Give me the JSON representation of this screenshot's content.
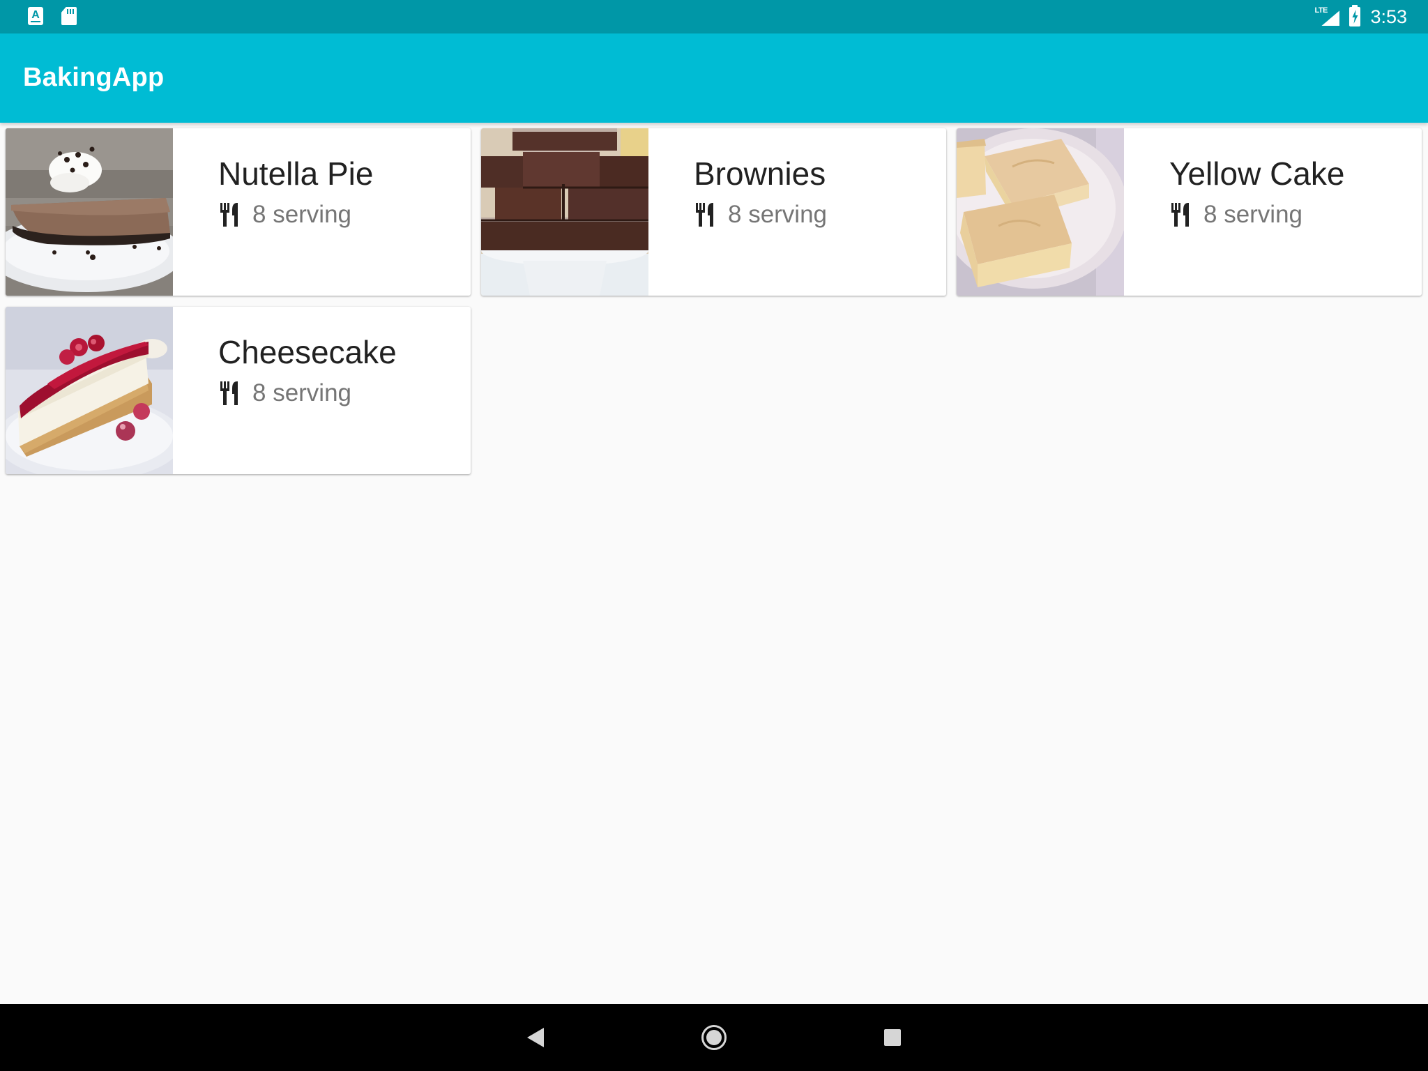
{
  "status_bar": {
    "notification_icons": [
      "android-app-icon",
      "sd-card-icon"
    ],
    "notification_app_letter": "A",
    "network_label": "LTE",
    "time": "3:53"
  },
  "app_bar": {
    "title": "BakingApp",
    "background_color": "#00bcd4",
    "status_bar_color": "#0097a7"
  },
  "recipes": [
    {
      "name": "Nutella Pie",
      "servings": "8 serving"
    },
    {
      "name": "Brownies",
      "servings": "8 serving"
    },
    {
      "name": "Yellow Cake",
      "servings": "8 serving"
    },
    {
      "name": "Cheesecake",
      "servings": "8 serving"
    }
  ],
  "nav_bar": {
    "buttons": [
      "back-icon",
      "home-icon",
      "recents-icon"
    ]
  }
}
